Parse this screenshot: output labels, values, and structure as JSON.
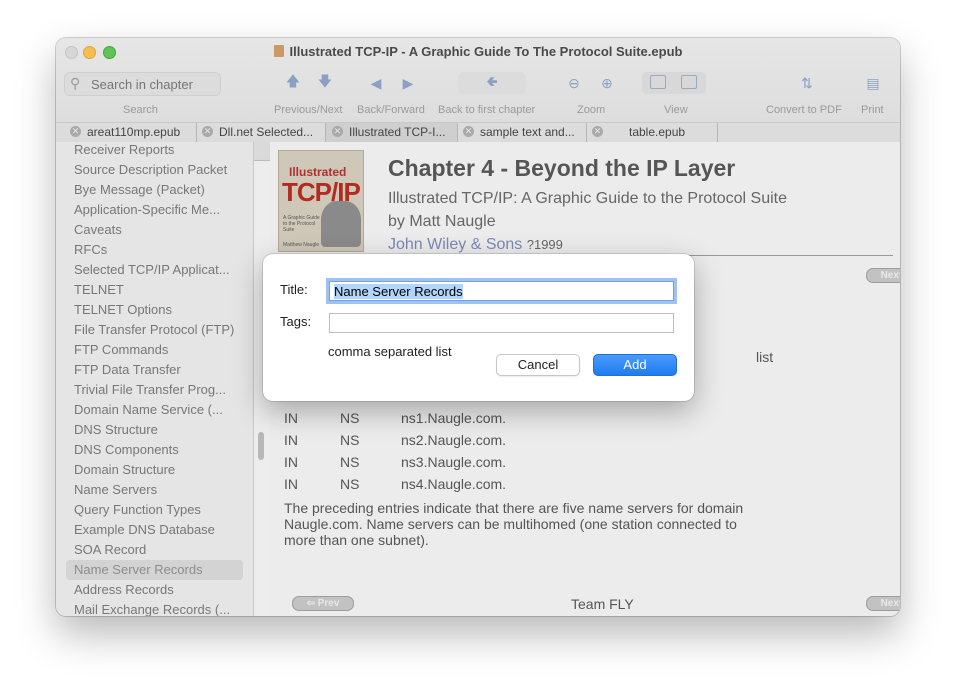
{
  "window": {
    "title": "Illustrated TCP-IP - A Graphic Guide To The Protocol Suite.epub"
  },
  "toolbar": {
    "search_placeholder": "Search in chapter",
    "labels": {
      "search": "Search",
      "prev_next": "Previous/Next",
      "back_forward": "Back/Forward",
      "back_to_first": "Back to first chapter",
      "zoom": "Zoom",
      "view": "View",
      "convert": "Convert to PDF",
      "print": "Print"
    },
    "icons": [
      "search-icon",
      "arrow-up-icon",
      "arrow-down-icon",
      "triangle-left-icon",
      "triangle-right-icon",
      "return-arrow-icon",
      "zoom-out-icon",
      "zoom-in-icon",
      "single-page-icon",
      "two-page-icon",
      "convert-icon",
      "print-icon"
    ]
  },
  "tabs": [
    {
      "label": "areat110mp.epub",
      "active": false
    },
    {
      "label": "Dll.net Selected...",
      "active": false
    },
    {
      "label": "Illustrated TCP-I...",
      "active": true
    },
    {
      "label": "sample text and...",
      "active": false
    },
    {
      "label": "table.epub",
      "active": false
    }
  ],
  "sidebar": {
    "items": [
      "Receiver Reports",
      "Source Description Packet",
      "Bye Message (Packet)",
      "Application-Specific Me...",
      "Caveats",
      "RFCs",
      "Selected TCP/IP Applicat...",
      "TELNET",
      "TELNET Options",
      "File Transfer Protocol (FTP)",
      "FTP Commands",
      "FTP Data Transfer",
      "Trivial File Transfer Prog...",
      "Domain Name Service (...",
      "DNS Structure",
      "DNS Components",
      "Domain Structure",
      "Name Servers",
      "Query Function Types",
      "Example DNS Database",
      "SOA Record",
      "Name Server Records",
      "Address Records",
      "Mail Exchange Records (..."
    ],
    "selected_index": 21
  },
  "content": {
    "cover": {
      "top": "Illustrated",
      "big": "TCP/IP",
      "sub": "A Graphic Guide to the Protocol Suite",
      "author": "Matthew Naugle"
    },
    "chapter_title": "Chapter 4 - Beyond the IP Layer",
    "book_title": "Illustrated TCP/IP: A Graphic Guide to the Protocol Suite",
    "author_line": "by Matt Naugle",
    "publisher": "John Wiley & Sons",
    "year": "?1999",
    "next_label": "Next ⇨",
    "prev_label": "⇦ Prev",
    "partial_list": "list",
    "records": [
      {
        "class": "IN",
        "type": "NS",
        "value": "ns1.Naugle.com."
      },
      {
        "class": "IN",
        "type": "NS",
        "value": "ns2.Naugle.com."
      },
      {
        "class": "IN",
        "type": "NS",
        "value": "ns3.Naugle.com."
      },
      {
        "class": "IN",
        "type": "NS",
        "value": "ns4.Naugle.com."
      }
    ],
    "paragraph": "The preceding entries indicate that there are five name servers for domain Naugle.com. Name servers can be multihomed (one station connected to more than one subnet).",
    "footer_text": "Team FLY"
  },
  "dialog": {
    "title_label": "Title:",
    "title_value": "Name Server Records",
    "tags_label": "Tags:",
    "tags_value": "",
    "hint": "comma separated list",
    "cancel_label": "Cancel",
    "add_label": "Add"
  },
  "colors": {
    "accent": "#1f7cf0",
    "publisher_link": "#7a8ab6",
    "cover_red": "#b32a20"
  }
}
